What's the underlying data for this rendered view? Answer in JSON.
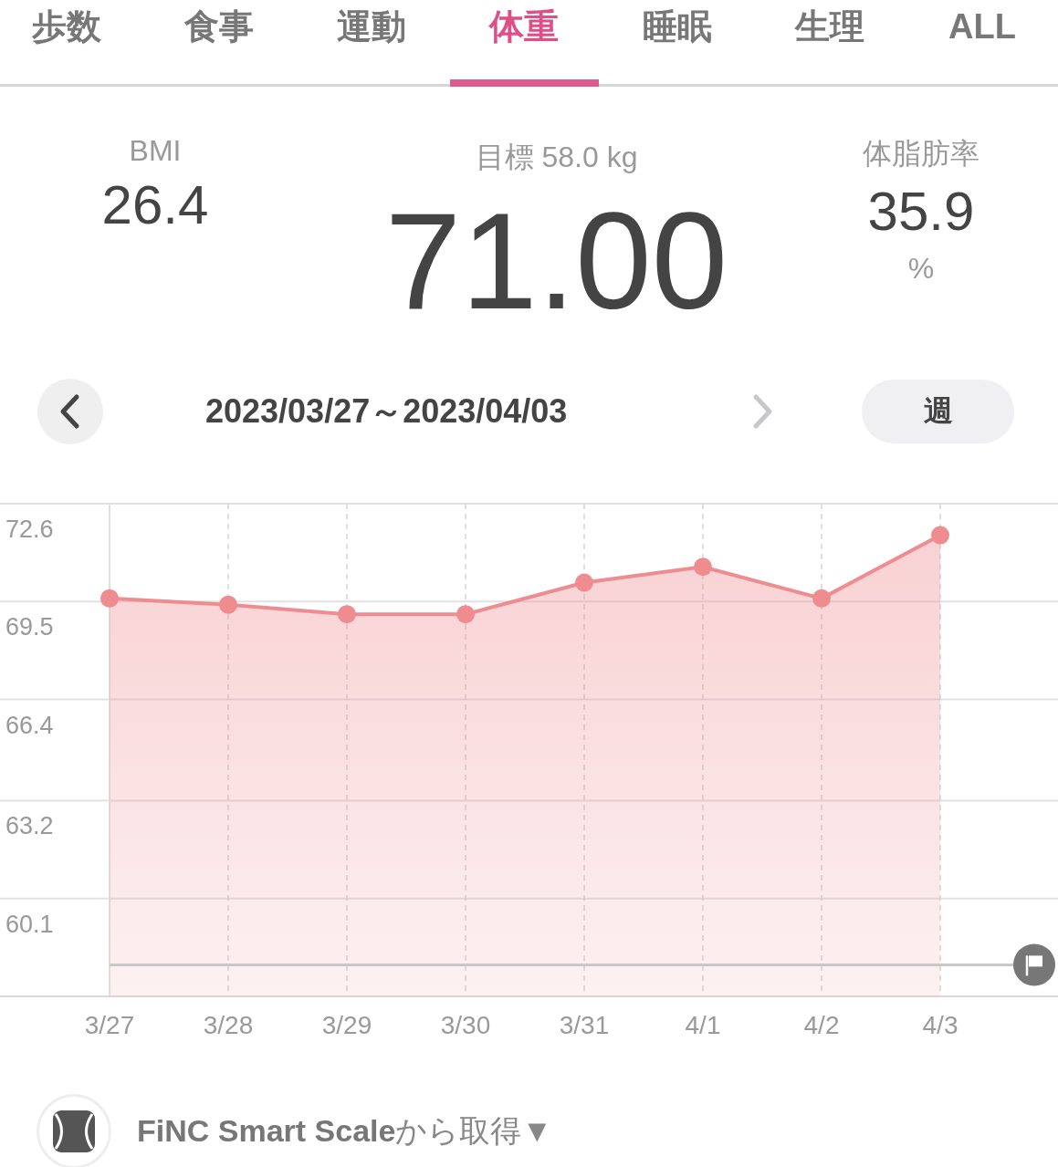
{
  "tabs": [
    {
      "label": "歩数",
      "selected": false
    },
    {
      "label": "食事",
      "selected": false
    },
    {
      "label": "運動",
      "selected": false
    },
    {
      "label": "体重",
      "selected": true
    },
    {
      "label": "睡眠",
      "selected": false
    },
    {
      "label": "生理",
      "selected": false
    },
    {
      "label": "ALL",
      "selected": false
    }
  ],
  "stats": {
    "bmi": {
      "label": "BMI",
      "value": "26.4"
    },
    "goal": "目標 58.0 kg",
    "weight": "71.00",
    "body_fat": {
      "label": "体脂肪率",
      "value": "35.9",
      "unit": "%"
    }
  },
  "period": {
    "range": "2023/03/27～2023/04/03",
    "prev_disabled": false,
    "next_disabled": true,
    "unit_button": "週"
  },
  "chart_data": {
    "type": "area",
    "categories": [
      "3/27",
      "3/28",
      "3/29",
      "3/30",
      "3/31",
      "4/1",
      "4/2",
      "4/3"
    ],
    "series": [
      {
        "color": "#ee8c90",
        "values": [
          69.6,
          69.4,
          69.1,
          69.1,
          70.1,
          70.6,
          69.6,
          71.6
        ]
      }
    ],
    "ylim": [
      57.0,
      72.6
    ],
    "yticks": [
      {
        "value": 72.6,
        "label": "72.6"
      },
      {
        "value": 69.5,
        "label": "69.5"
      },
      {
        "value": 66.4,
        "label": "66.4"
      },
      {
        "value": 63.2,
        "label": "63.2"
      },
      {
        "value": 60.1,
        "label": "60.1"
      }
    ],
    "grid": true,
    "ref_lines": [
      {
        "axis": "y",
        "value": 58.0
      }
    ]
  },
  "source": {
    "text": "**FiNC Smart Scale**から取得▼"
  }
}
